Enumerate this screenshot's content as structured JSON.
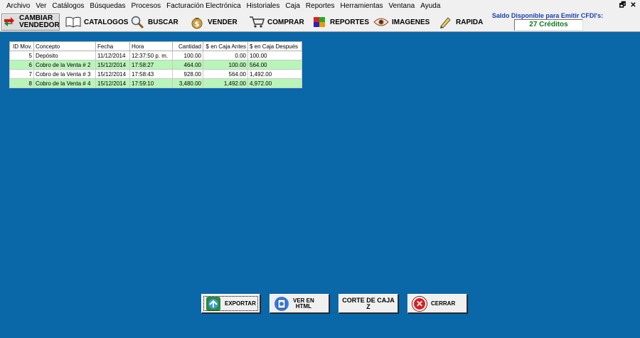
{
  "menu": [
    "Archivo",
    "Ver",
    "Catálogos",
    "Búsquedas",
    "Procesos",
    "Facturación Electrónica",
    "Historiales",
    "Caja",
    "Reportes",
    "Herramientas",
    "Ventana",
    "Ayuda"
  ],
  "window_controls": {
    "restore": "🗗",
    "close": "✕"
  },
  "toolbar": {
    "cambiar_line1": "CAMBIAR",
    "cambiar_line2": "VENDEDOR",
    "catalogos": "CATALOGOS",
    "buscar": "BUSCAR",
    "vender": "VENDER",
    "comprar": "COMPRAR",
    "reportes": "REPORTES",
    "imagenes": "IMAGENES",
    "rapida": "RAPIDA"
  },
  "saldo": {
    "label": "Saldo Disponible para Emitir CFDI's:",
    "value": "27 Créditos"
  },
  "table": {
    "headers": [
      "ID Mov.",
      "Concepto",
      "Fecha",
      "Hora",
      "Cantidad",
      "$ en Caja Antes",
      "$ en Caja Después"
    ],
    "rows": [
      [
        "5",
        "Depósito",
        "11/12/2014",
        "12:37:50 p. m.",
        "100.00",
        "0.00",
        "100.00"
      ],
      [
        "6",
        "Cobro de la Venta # 2",
        "15/12/2014",
        "17:58:27",
        "464.00",
        "100.00",
        "564.00"
      ],
      [
        "7",
        "Cobro de la Venta # 3",
        "15/12/2014",
        "17:58:43",
        "928.00",
        "564.00",
        "1,492.00"
      ],
      [
        "8",
        "Cobro de la Venta # 4",
        "15/12/2014",
        "17:59:10",
        "3,480.00",
        "1,492.00",
        "4,972.00"
      ]
    ]
  },
  "buttons": {
    "exportar": "EXPORTAR",
    "ver_line1": "VER EN",
    "ver_line2": "HTML",
    "corte_line1": "CORTE DE CAJA",
    "corte_line2": "Z",
    "cerrar": "CERRAR"
  },
  "colors": {
    "background": "#0a67a8",
    "row_highlight": "#b8f5b8",
    "saldo_value": "#0a7a1a",
    "saldo_label": "#1a3fb0"
  }
}
